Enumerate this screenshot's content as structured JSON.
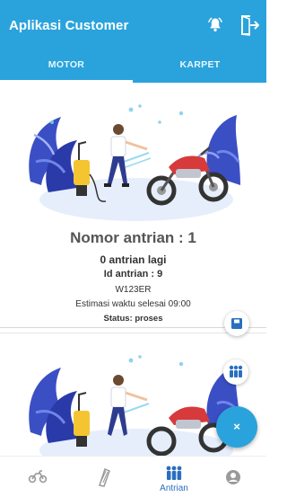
{
  "appbar": {
    "title": "Aplikasi Customer",
    "actions": [
      "bell-icon",
      "logout-icon"
    ]
  },
  "tabs": [
    {
      "label": "MOTOR",
      "active": true
    },
    {
      "label": "KARPET",
      "active": false
    }
  ],
  "queue_card": {
    "nomor": "Nomor antrian : 1",
    "sisa": "0 antrian lagi",
    "id": "Id antrian : 9",
    "plat": "W123ER",
    "estimasi": "Estimasi waktu selesai 09:00",
    "status": "Status: proses"
  },
  "fabs": {
    "close_label": "×"
  },
  "bottom_nav": [
    {
      "icon": "motorcycle-icon",
      "label": "",
      "active": false
    },
    {
      "icon": "carpet-icon",
      "label": "",
      "active": false
    },
    {
      "icon": "queue-people-icon",
      "label": "Antrian",
      "active": true
    },
    {
      "icon": "account-icon",
      "label": "",
      "active": false
    }
  ],
  "colors": {
    "primary": "#2aa3dc",
    "active_nav": "#2a6fbf",
    "illustration_blue": "#3b4fc4",
    "illustration_yellow": "#f4c531",
    "illustration_red": "#d63a3a"
  }
}
